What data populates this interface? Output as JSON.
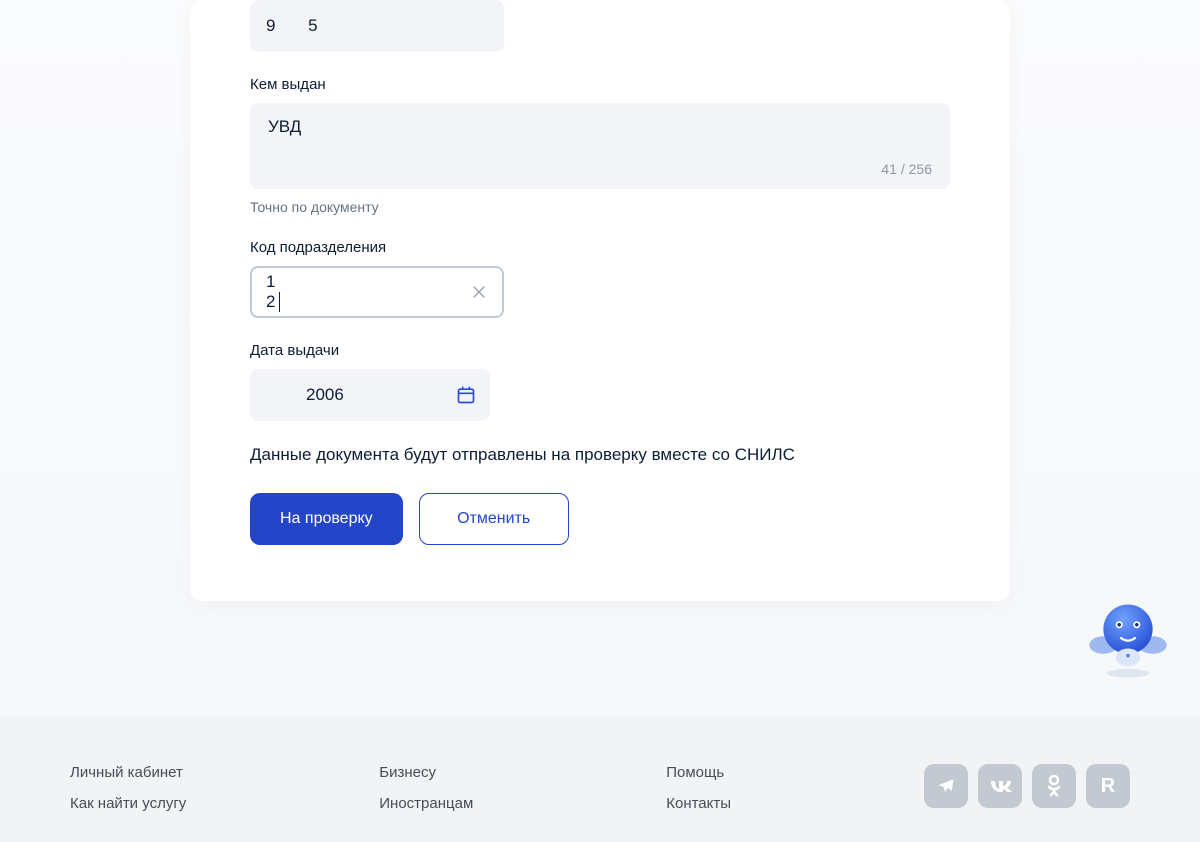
{
  "form": {
    "top_value": "9    5",
    "issued_by": {
      "label": "Кем выдан",
      "value": "УВД",
      "count": "41 / 256",
      "hint": "Точно по документу"
    },
    "dept_code": {
      "label": "Код подразделения",
      "value": "1    2"
    },
    "issue_date": {
      "label": "Дата выдачи",
      "value": "2006"
    },
    "info": "Данные документа будут отправлены на проверку вместе со СНИЛС",
    "submit": "На проверку",
    "cancel": "Отменить"
  },
  "footer": {
    "col1": [
      "Личный кабинет",
      "Как найти услугу"
    ],
    "col2": [
      "Бизнесу",
      "Иностранцам"
    ],
    "col3": [
      "Помощь",
      "Контакты"
    ],
    "social": {
      "r_label": "R"
    }
  }
}
